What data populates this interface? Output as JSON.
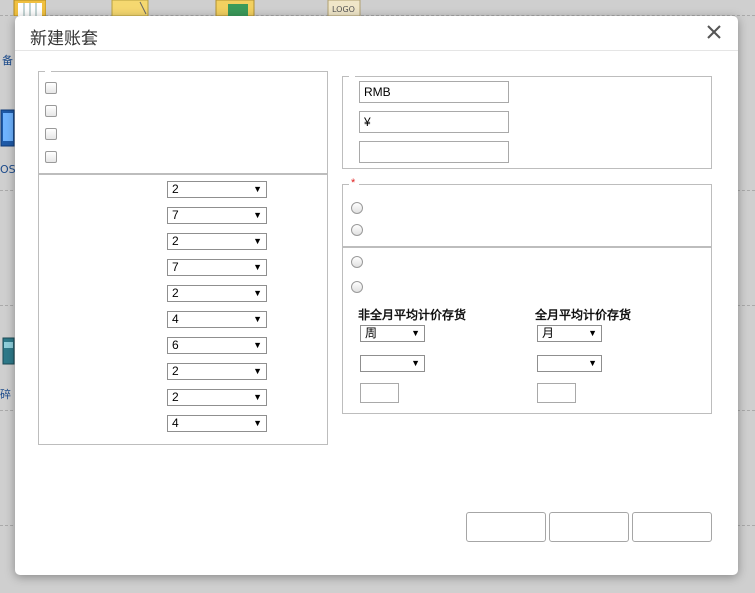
{
  "desktop": {
    "labels": [
      "备",
      "OS",
      "碎"
    ]
  },
  "dialog": {
    "title": "新建账套",
    "currency": {
      "code": "RMB",
      "symbol": "¥",
      "name": ""
    },
    "code_lengths": [
      "2",
      "7",
      "2",
      "7",
      "2",
      "4",
      "6",
      "2",
      "2",
      "4"
    ],
    "required_mark": "*",
    "valuation": {
      "non_monthly_label": "非全月平均计价存货",
      "monthly_label": "全月平均计价存货",
      "non_monthly_period": "周",
      "monthly_period": "月",
      "non_monthly_second": "",
      "monthly_second": ""
    }
  }
}
